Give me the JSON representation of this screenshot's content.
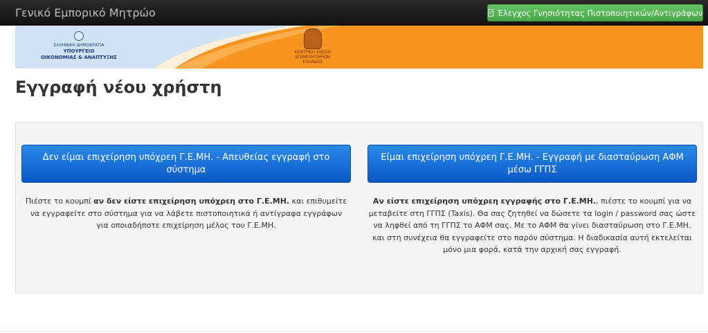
{
  "navbar": {
    "brand": "Γενικό Εμπορικό Μητρώο",
    "verify_button": "Έλεγχος Γνησιότητας Πιστοποιητικών/Αντιγράφων"
  },
  "banner": {
    "ministry": {
      "line1": "ΕΛΛΗΝΙΚΗ ΔΗΜΟΚΡΑΤΙΑ",
      "line2": "ΥΠΟΥΡΓΕΙΟ",
      "line3": "ΟΙΚΟΝΟΜΙΑΣ & ΑΝΑΠΤΥΞΗΣ"
    },
    "chamber": {
      "line1": "ΚΕΝΤΡΙΚΗ ΕΝΩΣΗ",
      "line2": "ΕΠΙΜΕΛΗΤΗΡΙΩΝ",
      "line3": "ΕΛΛΑΔΟΣ"
    },
    "colors": {
      "orange": "#f7941d",
      "light_blue": "#cfe3f5"
    }
  },
  "page": {
    "title": "Εγγραφή νέου χρήστη"
  },
  "options": {
    "left": {
      "button": "Δεν είμαι επιχείρηση υπόχρεη Γ.Ε.ΜΗ. - Απευθείας εγγραφή στο σύστημα",
      "desc_pre": "Πιέστε το κουμπί ",
      "desc_bold": "αν δεν είστε επιχείρηση υπόχρεη στο Γ.Ε.ΜΗ.",
      "desc_post": " και επιθυμείτε να εγγραφείτε στο σύστημα για να λάβετε πιστοποιητικά ή αντίγραφα εγγράφων για οποιαδήποτε επιχείρηση μέλος του Γ.Ε.ΜΗ."
    },
    "right": {
      "button": "Είμαι επιχείρηση υπόχρεη Γ.Ε.ΜΗ. - Εγγραφή με διασταύρωση ΑΦΜ μέσω ΓΓΠΣ",
      "desc_bold": "Αν είστε επιχείρηση υπόχρεη εγγραφής στο Γ.Ε.ΜΗ.",
      "desc_post": ", πιέστε το κουμπί για να μεταβείτε στη ΓΓΠΣ (Taxis). Θα σας ζητηθεί να δώσετε τα login / password σας ώστε να ληφθεί από τη ΓΓΠΣ το ΑΦΜ σας. Με το ΑΦΜ θα γίνει διασταύρωση στο Γ.Ε.ΜΗ. και στη συνέχεια θα εγγραφείτε στο παρόν σύστημα. Η διαδικασία αυτή εκτελείται μόνο μια φορά, κατά την αρχική σας εγγραφή."
    }
  }
}
